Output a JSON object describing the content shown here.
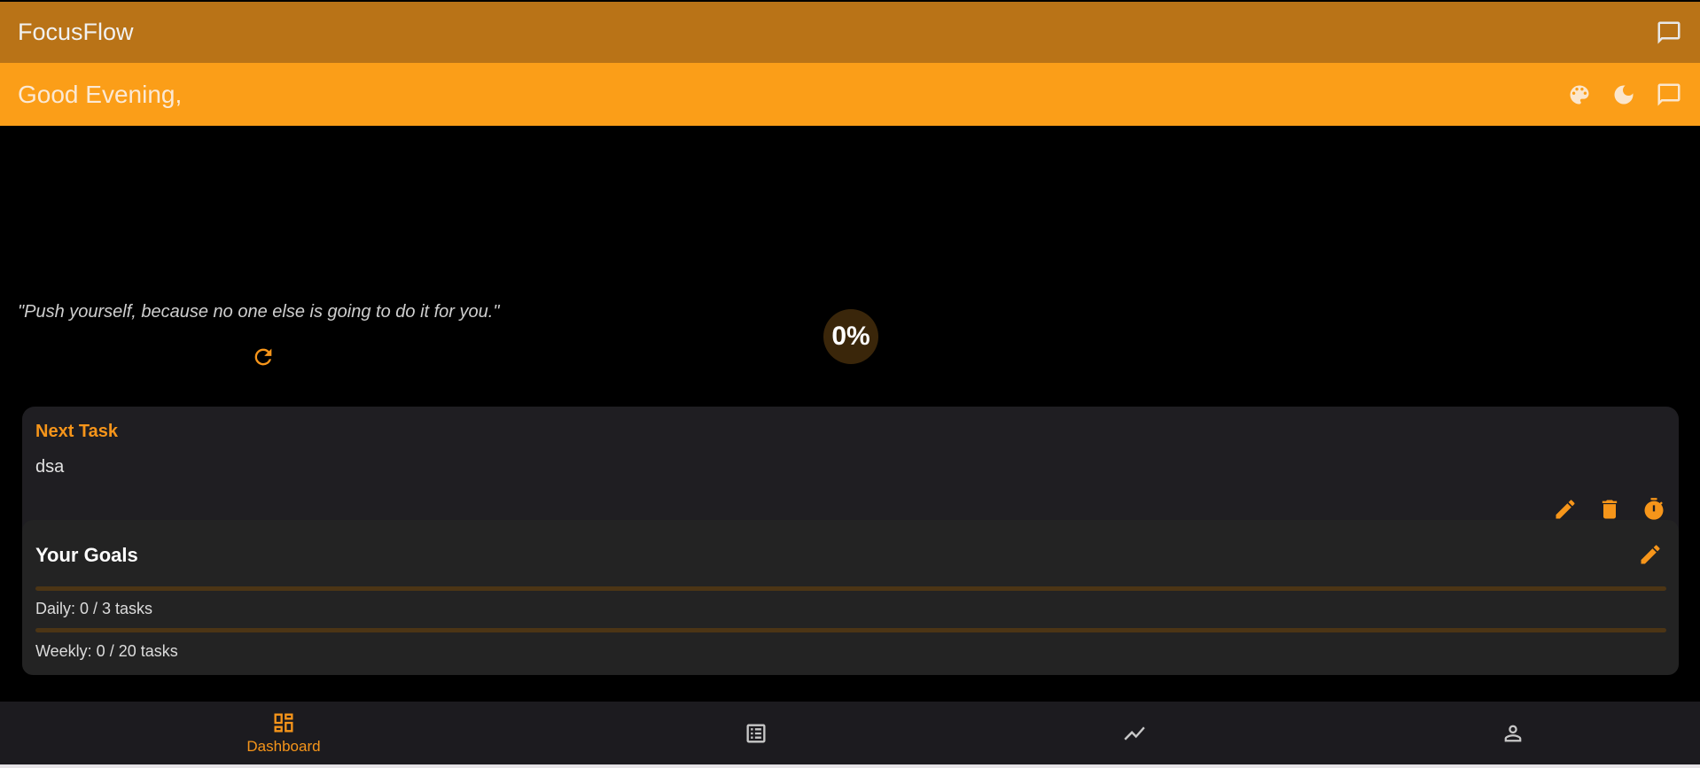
{
  "appbar": {
    "title": "FocusFlow",
    "icon": "chat-icon"
  },
  "greeting": {
    "text": "Good Evening,",
    "icons": [
      "palette-icon",
      "dark-mode-icon",
      "chat-icon"
    ]
  },
  "quote": {
    "text": "\"Push yourself, because no one else is going to do it for you.\"",
    "refresh_icon": "refresh-icon"
  },
  "progress": {
    "label": "0%",
    "value": 0
  },
  "next_task": {
    "label": "Next Task",
    "task": "dsa",
    "actions": [
      "edit-icon",
      "delete-icon",
      "timer-icon"
    ]
  },
  "goals": {
    "title": "Your Goals",
    "daily": {
      "label": "Daily: 0 / 3 tasks",
      "done": 0,
      "total": 3
    },
    "weekly": {
      "label": "Weekly: 0 / 20 tasks",
      "done": 0,
      "total": 20
    }
  },
  "nav": [
    {
      "label": "Dashboard",
      "icon": "dashboard-icon",
      "active": true
    },
    {
      "label": "",
      "icon": "list-icon",
      "active": false
    },
    {
      "label": "",
      "icon": "trending-icon",
      "active": false
    },
    {
      "label": "",
      "icon": "person-icon",
      "active": false
    }
  ],
  "colors": {
    "appbar": "#b97317",
    "greeting_bar": "#fb9e18",
    "accent": "#f6951a",
    "background": "#000000",
    "card": "#1f1e22"
  }
}
